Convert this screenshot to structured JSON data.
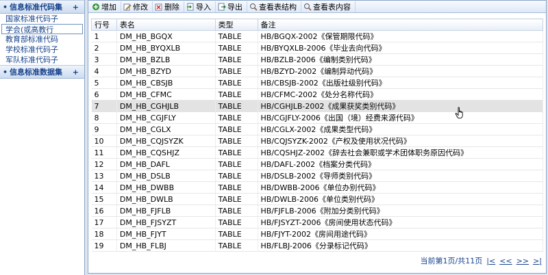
{
  "sidebar": {
    "groups": [
      {
        "title": "信息标准代码集",
        "expand": "+",
        "items": [
          "国家标准代码子",
          "学会(或高教行",
          "教育部标准代码",
          "学校标准代码子",
          "军队标准代码子"
        ],
        "selected_index": 1
      },
      {
        "title": "信息标准数据集",
        "expand": "+",
        "items": []
      }
    ]
  },
  "toolbar": {
    "buttons": [
      {
        "id": "add",
        "label": "增加",
        "icon": "add-icon"
      },
      {
        "id": "edit",
        "label": "修改",
        "icon": "edit-icon"
      },
      {
        "id": "delete",
        "label": "删除",
        "icon": "delete-icon"
      },
      {
        "id": "import",
        "label": "导入",
        "icon": "import-icon"
      },
      {
        "id": "export",
        "label": "导出",
        "icon": "export-icon"
      },
      {
        "id": "view-structure",
        "label": "查看表结构",
        "icon": "search-icon"
      },
      {
        "id": "view-content",
        "label": "查看表内容",
        "icon": "search-icon"
      }
    ]
  },
  "table": {
    "columns": [
      "行号",
      "表名",
      "类型",
      "备注"
    ],
    "hover_row": 6,
    "rows": [
      [
        "1",
        "DM_HB_BGQX",
        "TABLE",
        "HB/BGQX-2002《保管期限代码》"
      ],
      [
        "2",
        "DM_HB_BYQXLB",
        "TABLE",
        "HB/BYQXLB-2006《毕业去向代码》"
      ],
      [
        "3",
        "DM_HB_BZLB",
        "TABLE",
        "HB/BZLB-2006《编制类别代码》"
      ],
      [
        "4",
        "DM_HB_BZYD",
        "TABLE",
        "HB/BZYD-2002《编制异动代码》"
      ],
      [
        "5",
        "DM_HB_CBSJB",
        "TABLE",
        "HB/CBSJB-2002《出版社级别代码》"
      ],
      [
        "6",
        "DM_HB_CFMC",
        "TABLE",
        "HB/CFMC-2002《处分名称代码》"
      ],
      [
        "7",
        "DM_HB_CGHJLB",
        "TABLE",
        "HB/CGHJLB-2002《成果获奖类别代码》"
      ],
      [
        "8",
        "DM_HB_CGJFLY",
        "TABLE",
        "HB/CGJFLY-2006《出国（境）经费来源代码》"
      ],
      [
        "9",
        "DM_HB_CGLX",
        "TABLE",
        "HB/CGLX-2002《成果类型代码》"
      ],
      [
        "10",
        "DM_HB_CQJSYZK",
        "TABLE",
        "HB/CQJSYZK-2002《产权及使用状况代码》"
      ],
      [
        "11",
        "DM_HB_CQSHJZ",
        "TABLE",
        "HB/CQSHJZ-2002《辞去社会兼职或学术团体职务原因代码》"
      ],
      [
        "12",
        "DM_HB_DAFL",
        "TABLE",
        "HB/DAFL-2002《档案分类代码》"
      ],
      [
        "13",
        "DM_HB_DSLB",
        "TABLE",
        "HB/DSLB-2002《导师类别代码》"
      ],
      [
        "14",
        "DM_HB_DWBB",
        "TABLE",
        "HB/DWBB-2006《单位办别代码》"
      ],
      [
        "15",
        "DM_HB_DWLB",
        "TABLE",
        "HB/DWLB-2006《单位类别代码》"
      ],
      [
        "16",
        "DM_HB_FJFLB",
        "TABLE",
        "HB/FJFLB-2006《附加分类别代码》"
      ],
      [
        "17",
        "DM_HB_FJSYZT",
        "TABLE",
        "HB/FJSYZT-2006《房间使用状态代码》"
      ],
      [
        "18",
        "DM_HB_FJYT",
        "TABLE",
        "HB/FJYT-2002《房间用途代码》"
      ],
      [
        "19",
        "DM_HB_FLBJ",
        "TABLE",
        "HB/FLBJ-2006《分录标记代码》"
      ]
    ]
  },
  "pager": {
    "status": "当前第1页/共11页",
    "first": "|<",
    "prev": "<<",
    "next": ">>",
    "last": ">|"
  }
}
